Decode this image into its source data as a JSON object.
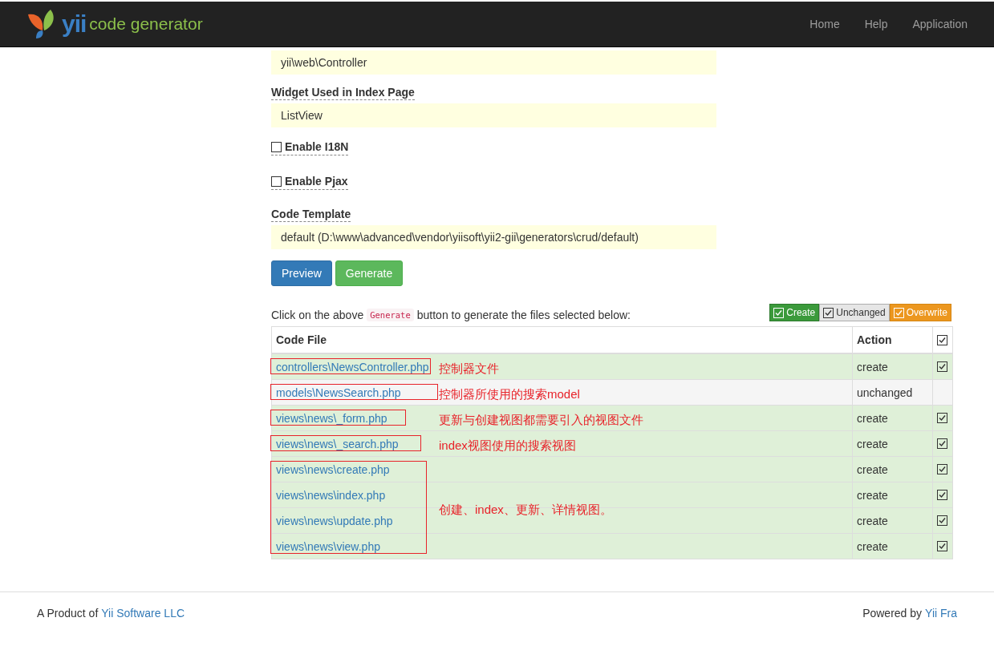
{
  "navbar": {
    "brand_mark": "yii",
    "brand_text": "code generator",
    "links": [
      {
        "label": "Home"
      },
      {
        "label": "Help"
      },
      {
        "label": "Application"
      }
    ]
  },
  "fields": [
    {
      "kind": "text",
      "value": "yii\\web\\Controller"
    },
    {
      "kind": "text",
      "label": "Widget Used in Index Page",
      "value": "ListView"
    },
    {
      "kind": "checkbox",
      "label": "Enable I18N",
      "checked": false
    },
    {
      "kind": "checkbox",
      "label": "Enable Pjax",
      "checked": false
    },
    {
      "kind": "text",
      "label": "Code Template",
      "value": "default (D:\\www\\advanced\\vendor\\yiisoft\\yii2-gii\\generators\\crud/default)"
    }
  ],
  "buttons": [
    {
      "label": "Preview",
      "kind": "primary"
    },
    {
      "label": "Generate",
      "kind": "success"
    }
  ],
  "instruction": {
    "before": "Click on the above",
    "code": "Generate",
    "after": "button to generate the files selected below:"
  },
  "legend": [
    {
      "label": "Create",
      "kind": "create",
      "checked": true
    },
    {
      "label": "Unchanged",
      "kind": "unchanged",
      "checked": true
    },
    {
      "label": "Overwrite",
      "kind": "overwrite",
      "checked": true
    }
  ],
  "table": {
    "columns": [
      "Code File",
      "Action"
    ],
    "all_checked": true,
    "groups": [
      {
        "note": "控制器文件",
        "rows": [
          {
            "file": "controllers\\NewsController.php",
            "action": "create",
            "kind": "create",
            "checked": true
          }
        ]
      },
      {
        "note": "控制器所使用的搜索model",
        "rows": [
          {
            "file": "models\\NewsSearch.php",
            "action": "unchanged",
            "kind": "unchanged"
          }
        ]
      },
      {
        "note": "更新与创建视图都需要引入的视图文件",
        "rows": [
          {
            "file": "views\\news\\_form.php",
            "action": "create",
            "kind": "create",
            "checked": true
          }
        ]
      },
      {
        "note": "index视图使用的搜索视图",
        "rows": [
          {
            "file": "views\\news\\_search.php",
            "action": "create",
            "kind": "create",
            "checked": true
          }
        ]
      },
      {
        "note": "创建、index、更新、详情视图。",
        "rows": [
          {
            "file": "views\\news\\create.php",
            "action": "create",
            "kind": "create",
            "checked": true
          },
          {
            "file": "views\\news\\index.php",
            "action": "create",
            "kind": "create",
            "checked": true
          },
          {
            "file": "views\\news\\update.php",
            "action": "create",
            "kind": "create",
            "checked": true
          },
          {
            "file": "views\\news\\view.php",
            "action": "create",
            "kind": "create",
            "checked": true
          }
        ]
      }
    ]
  },
  "footer": {
    "left_text": "A Product of",
    "left_link": "Yii Software LLC",
    "right_text": "Powered by",
    "right_link": "Yii Fra"
  }
}
